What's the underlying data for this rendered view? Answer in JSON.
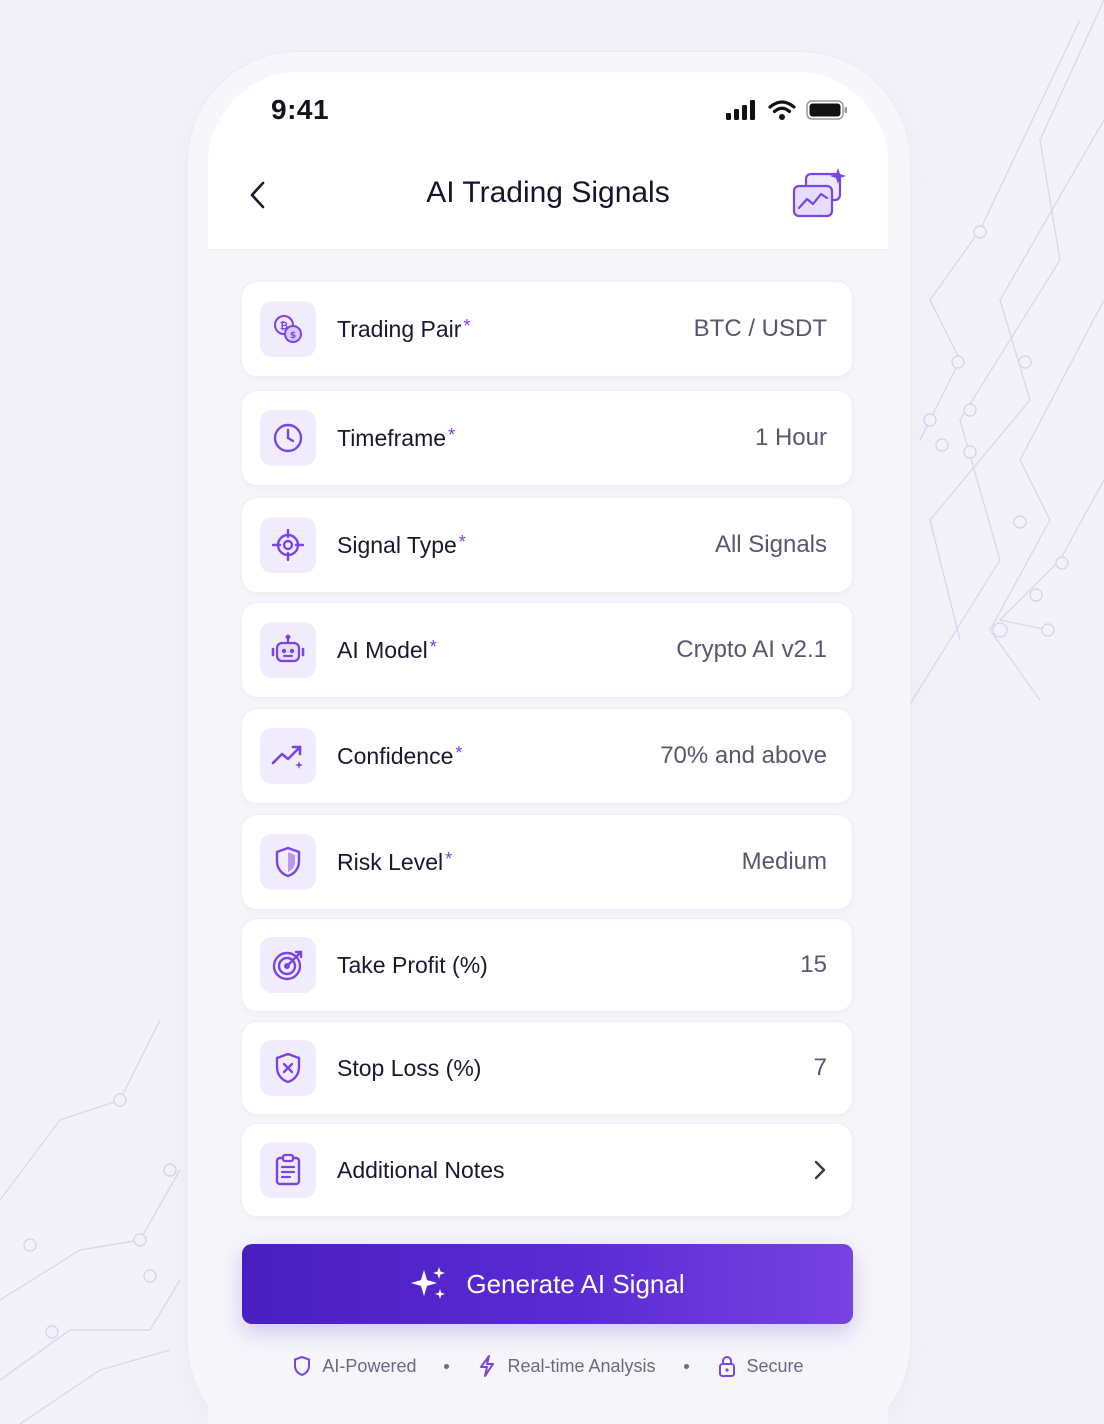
{
  "status_bar": {
    "time": "9:41"
  },
  "header": {
    "title": "AI Trading Signals"
  },
  "form": {
    "rows": [
      {
        "label": "Trading Pair",
        "required": "*",
        "value": "BTC / USDT",
        "icon": "coins-icon"
      },
      {
        "label": "Timeframe",
        "required": "*",
        "value": "1 Hour",
        "icon": "clock-icon"
      },
      {
        "label": "Signal Type",
        "required": "*",
        "value": "All Signals",
        "icon": "crosshair-icon"
      },
      {
        "label": "AI Model",
        "required": "*",
        "value": "Crypto AI v2.1",
        "icon": "robot-icon"
      },
      {
        "label": "Confidence",
        "required": "*",
        "value": "70% and above",
        "icon": "trend-up-icon"
      },
      {
        "label": "Risk Level",
        "required": "*",
        "value": "Medium",
        "icon": "shield-icon"
      },
      {
        "label": "Take Profit (%)",
        "required": "",
        "value": "15",
        "icon": "target-icon"
      },
      {
        "label": "Stop Loss (%)",
        "required": "",
        "value": "7",
        "icon": "shield-x-icon"
      },
      {
        "label": "Additional Notes",
        "required": "",
        "value": "",
        "icon": "clipboard-icon"
      }
    ]
  },
  "generate_button": {
    "label": "Generate AI Signal"
  },
  "features": [
    {
      "label": "AI-Powered",
      "icon": "shield-icon"
    },
    {
      "label": "Real-time Analysis",
      "icon": "lightning-icon"
    },
    {
      "label": "Secure",
      "icon": "lock-icon"
    }
  ],
  "colors": {
    "accent": "#6a35e0",
    "button_start": "#4a1fc0",
    "button_end": "#7742e0",
    "icon_bg": "#f0ecfb"
  }
}
